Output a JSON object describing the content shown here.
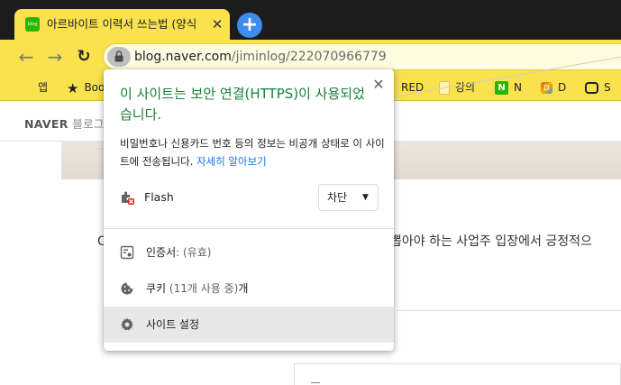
{
  "browser": {
    "tab": {
      "title": "아르바이트 이력서 쓰는법 (양식",
      "favicon_text": "blog",
      "close_glyph": "✕",
      "favicon_color": "#2db400",
      "background": "#f9e24e"
    },
    "new_tab_glyph": "+",
    "new_tab_color": "#3f8cf1",
    "nav": {
      "back_glyph": "←",
      "forward_glyph": "→",
      "reload_glyph": "↻"
    },
    "address": {
      "host": "blog.naver.com",
      "path": "/jiminlog/222070966779",
      "security_icon": "lock-icon"
    }
  },
  "bookmarks": [
    {
      "label": "앱",
      "icon": "apps-grid-icon"
    },
    {
      "label": "Boo",
      "icon": "star-icon"
    },
    {
      "label": "RED",
      "icon": "none"
    },
    {
      "label": "강의",
      "icon": "folder-icon"
    },
    {
      "label": "N",
      "icon": "naver-icon"
    },
    {
      "label": "D",
      "icon": "d-app-icon"
    },
    {
      "label": "S",
      "icon": "chat-icon"
    }
  ],
  "page": {
    "logo_bold": "NAVER",
    "logo_light": "블로그",
    "text_left": "O",
    "text_right": "뽑아야 하는 사업주 입장에서 긍정적으"
  },
  "popup": {
    "title": "이 사이트는 보안 연결(HTTPS)이 사용되었습니다.",
    "title_color": "#188038",
    "close_glyph": "✕",
    "description": "비밀번호나 신용카드 번호 등의 정보는 비공개 상태로 이 사이트에 전송됩니다.",
    "learn_more": "자세히 알아보기",
    "link_color": "#1a73e8",
    "flash": {
      "label": "Flash",
      "icon": "plugin-blocked-icon",
      "selected": "차단",
      "caret": "▼"
    },
    "menu": [
      {
        "icon": "certificate-icon",
        "label": "인증서",
        "detail": ": (유효)"
      },
      {
        "icon": "cookie-icon",
        "label": "쿠키",
        "detail": " (11개 사용 중)",
        "suffix": "개"
      },
      {
        "icon": "gear-icon",
        "label": "사이트 설정",
        "detail": "",
        "highlighted": true
      }
    ]
  }
}
